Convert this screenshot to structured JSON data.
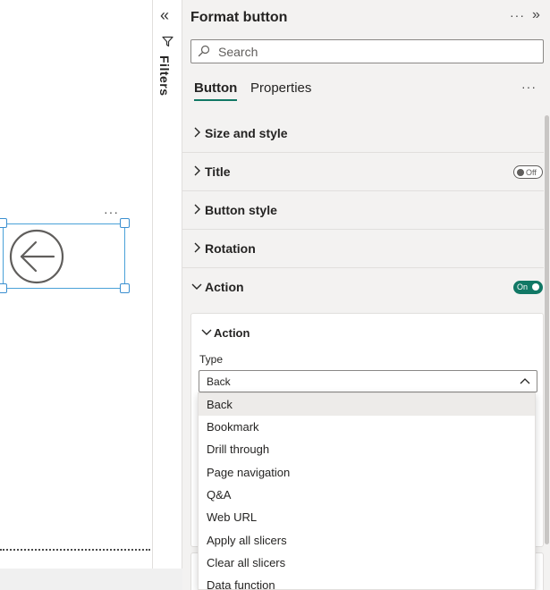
{
  "filters_pane": {
    "label": "Filters",
    "collapse_icon": "double-chevron-left-icon",
    "funnel_icon": "funnel-icon"
  },
  "canvas": {
    "visual_more": "···",
    "visual_icon": "back-arrow-circle-icon"
  },
  "format_pane": {
    "title": "Format button",
    "more": "···",
    "expand_icon": "double-chevron-right-icon",
    "search": {
      "placeholder": "Search"
    },
    "tabs": [
      {
        "label": "Button",
        "active": true
      },
      {
        "label": "Properties",
        "active": false
      }
    ],
    "tabs_more": "···",
    "sections": [
      {
        "label": "Size and style",
        "expanded": false
      },
      {
        "label": "Title",
        "expanded": false,
        "toggle": "Off"
      },
      {
        "label": "Button style",
        "expanded": false
      },
      {
        "label": "Rotation",
        "expanded": false
      },
      {
        "label": "Action",
        "expanded": true,
        "toggle": "On"
      }
    ],
    "action_card": {
      "title": "Action",
      "type_label": "Type",
      "type_value": "Back"
    },
    "type_options": [
      "Back",
      "Bookmark",
      "Drill through",
      "Page navigation",
      "Q&A",
      "Web URL",
      "Apply all slicers",
      "Clear all slicers",
      "Data function"
    ],
    "selected_option": "Back"
  },
  "colors": {
    "accent": "#117865",
    "selection_border": "#4aa1d8",
    "pane_bg": "#f3f2f1"
  }
}
